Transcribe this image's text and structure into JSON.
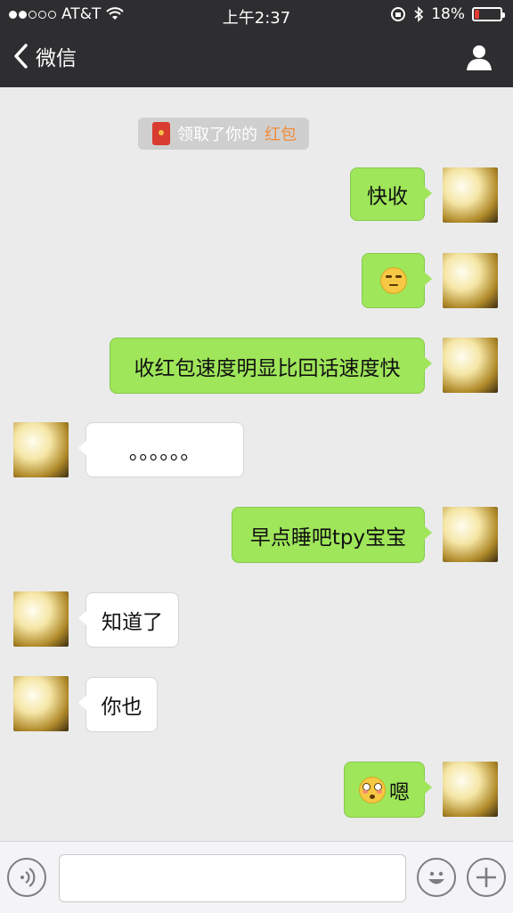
{
  "status_bar": {
    "carrier": "AT&T",
    "time": "上午2:37",
    "battery": "18%",
    "battery_level": 0.18,
    "signal_bars_filled": 2,
    "signal_bars_total": 5
  },
  "nav": {
    "back_label": "微信"
  },
  "system_message": {
    "text": "领取了你的",
    "highlight": "红包"
  },
  "messages": [
    {
      "from": "me",
      "text": "快收"
    },
    {
      "from": "me",
      "emoji": "unamused-face"
    },
    {
      "from": "me",
      "text": "收红包速度明显比回话速度快"
    },
    {
      "from": "other",
      "text": "。。。。。。"
    },
    {
      "from": "me",
      "text": "早点睡吧tpy宝宝"
    },
    {
      "from": "other",
      "text": "知道了"
    },
    {
      "from": "other",
      "text": "你也"
    },
    {
      "from": "me",
      "emoji": "flushed-face",
      "text": "嗯"
    }
  ],
  "colors": {
    "nav_bg": "#2e2e30",
    "outgoing_bubble": "#9fe65a",
    "incoming_bubble": "#ffffff",
    "chat_bg": "#ebebeb",
    "redpacket_highlight": "#f08c3a"
  },
  "input_bar": {
    "icons": [
      "voice-icon",
      "emoji-icon",
      "plus-icon"
    ]
  }
}
